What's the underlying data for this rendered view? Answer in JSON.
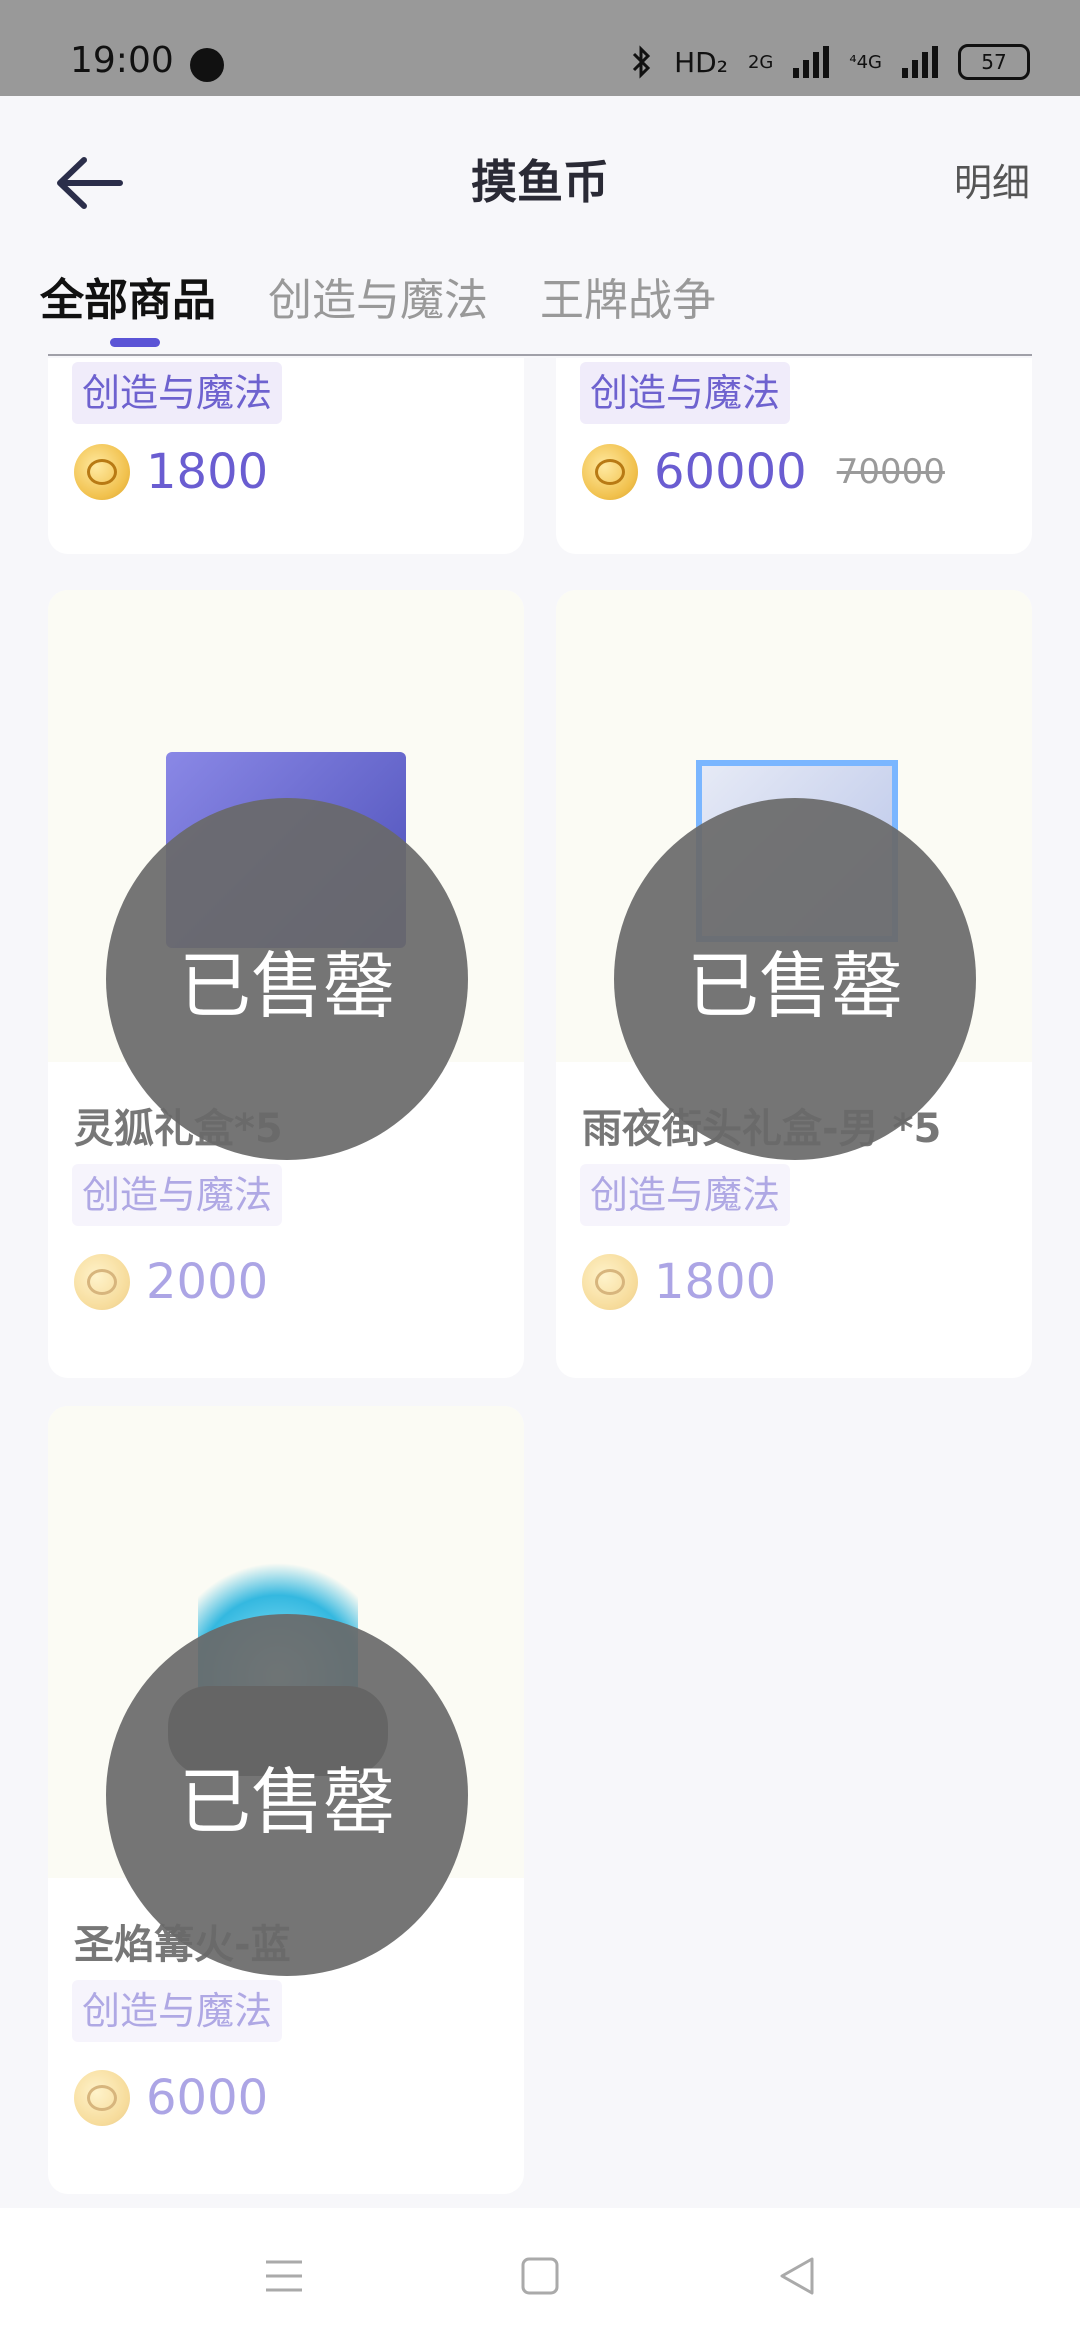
{
  "status_bar": {
    "time": "19:00",
    "hd": "HD₂",
    "net1": "2G",
    "net2": "⁴4G",
    "battery": "57",
    "icons": [
      "globe-icon",
      "bluetooth-icon",
      "signal-icon",
      "battery-icon"
    ]
  },
  "header": {
    "title": "摸鱼币",
    "detail_link": "明细",
    "back_icon": "arrow-left-icon"
  },
  "tabs": [
    {
      "label": "全部商品",
      "active": true
    },
    {
      "label": "创造与魔法",
      "active": false
    },
    {
      "label": "王牌战争",
      "active": false
    }
  ],
  "products": [
    {
      "category": "创造与魔法",
      "price": "1800"
    },
    {
      "category": "创造与魔法",
      "price": "60000",
      "original_price": "70000"
    },
    {
      "name": "灵狐礼盒*5",
      "category": "创造与魔法",
      "price": "2000",
      "sold_out_label": "已售罄"
    },
    {
      "name": "雨夜街头礼盒-男 *5",
      "category": "创造与魔法",
      "price": "1800",
      "sold_out_label": "已售罄"
    },
    {
      "name": "圣焰篝火-蓝",
      "category": "创造与魔法",
      "price": "6000",
      "sold_out_label": "已售罄"
    }
  ],
  "colors": {
    "accent": "#5b54d6",
    "price": "#6a5dd1",
    "tag_bg": "#f0ecfa",
    "sold_out_overlay": "#696969"
  },
  "nav_icons": [
    "menu-icon",
    "home-square-icon",
    "back-triangle-icon"
  ]
}
